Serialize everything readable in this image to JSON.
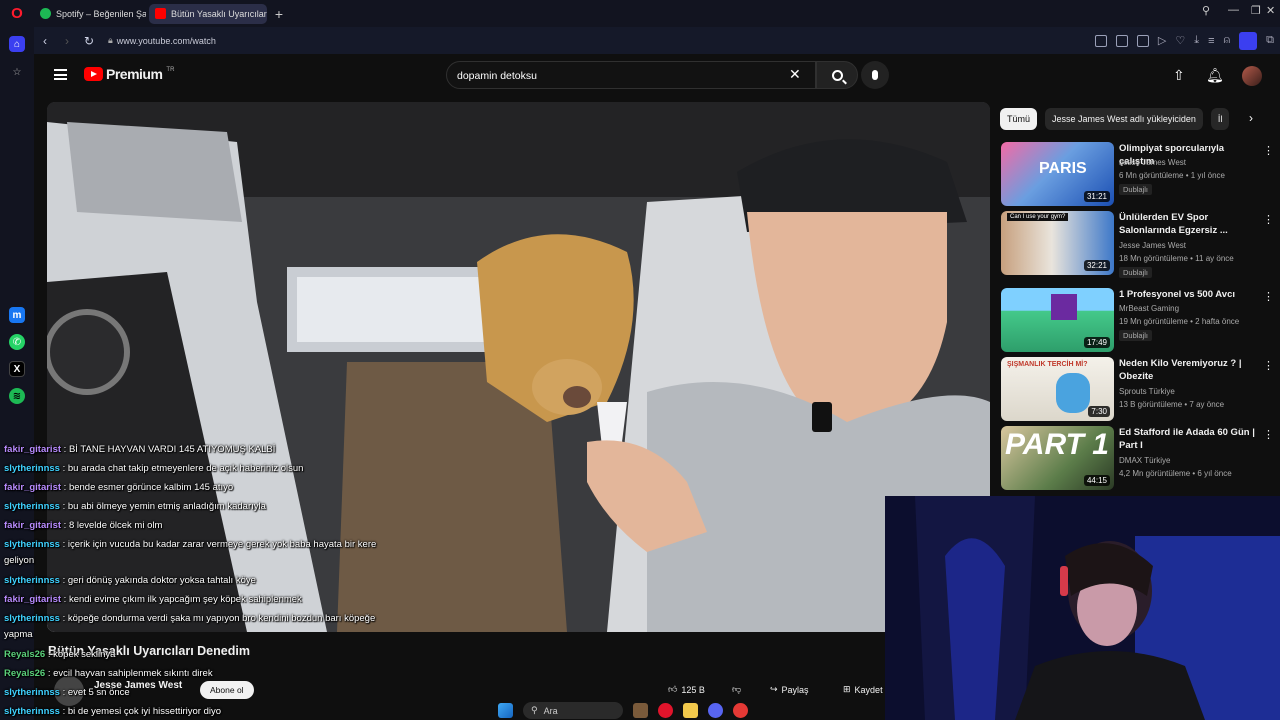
{
  "browser": {
    "tabs": [
      {
        "label": "Spotify – Beğenilen Şarkıla",
        "active": false,
        "favicon_color": "#1db954"
      },
      {
        "label": "Bütün Yasaklı Uyarıcılar",
        "active": true,
        "favicon_color": "#ff0000"
      }
    ],
    "url": "www.youtube.com/watch",
    "accent": "#ff1b2d"
  },
  "youtube": {
    "logo_text": "Premium",
    "logo_suffix": "TR",
    "search_query": "dopamin detoksu",
    "filter_chips": [
      "Tümü",
      "Jesse James West adlı yükleyiciden",
      "İl"
    ],
    "recommendations": [
      {
        "title": "Olimpiyat sporcularıyla çalıştım",
        "channel": "Jesse James West",
        "verified": true,
        "meta": "6 Mn görüntüleme • 1 yıl önce",
        "badge": "Dublajlı",
        "duration": "31:21"
      },
      {
        "title": "Ünlülerden EV Spor Salonlarında Egzersiz ...",
        "channel": "Jesse James West",
        "verified": true,
        "meta": "18 Mn görüntüleme • 11 ay önce",
        "badge": "Dublajlı",
        "duration": "32:21"
      },
      {
        "title": "1 Profesyonel vs 500 Avcı",
        "channel": "MrBeast Gaming",
        "verified": true,
        "meta": "19 Mn görüntüleme • 2 hafta önce",
        "badge": "Dublajlı",
        "duration": "17:49"
      },
      {
        "title": "Neden Kilo Veremiyoruz ? | Obezite",
        "channel": "Sprouts Türkiye",
        "verified": false,
        "meta": "13 B görüntüleme • 7 ay önce",
        "badge": "",
        "duration": "7:30"
      },
      {
        "title": "Ed Stafford ile Adada 60 Gün | Part I",
        "channel": "DMAX Türkiye",
        "verified": true,
        "meta": "4,2 Mn görüntüleme • 6 yıl önce",
        "badge": "",
        "duration": "44:15"
      }
    ],
    "video_title": "Bütün Yasaklı Uyarıcıları Denedim",
    "channel_name": "Jesse James West",
    "subscribe_label": "Abone ol",
    "likes": "125 B",
    "share_label": "Paylaş",
    "save_label": "Kaydet"
  },
  "chat": [
    {
      "user": "fakir_gitarist",
      "text": ": Bİ TANE HAYVAN VARDI 145 ATIYOMUŞ KALBİ",
      "color": "#b98cff"
    },
    {
      "user": "slytherinnss",
      "text": ": bu arada chat takip etmeyenlere de açık haberiniz olsun",
      "color": "#3fd1ff"
    },
    {
      "user": "fakir_gitarist",
      "text": ": bende esmer görünce kalbim 145 atıyo",
      "color": "#b98cff"
    },
    {
      "user": "slytherinnss",
      "text": ": bu abi ölmeye yemin etmiş anladığım kadarıyla",
      "color": "#3fd1ff"
    },
    {
      "user": "fakir_gitarist",
      "text": ": 8 levelde ölcek mi olm",
      "color": "#b98cff"
    },
    {
      "user": "slytherinnss",
      "text": ": içerik için vucuda bu kadar zarar vermeye gerek yok baba hayata bir kere geliyon",
      "color": "#3fd1ff"
    },
    {
      "user": "slytherinnss",
      "text": ": geri dönüş yakında doktor yoksa tahtalı köye",
      "color": "#3fd1ff"
    },
    {
      "user": "fakir_gitarist",
      "text": ": kendi evime çıkım ilk yapcağım şey köpek sahiplenmek",
      "color": "#b98cff"
    },
    {
      "user": "slytherinnss",
      "text": ": köpeğe dondurma verdi şaka mı yapıyon bro kendini bozdun barı köpeğe yapma",
      "color": "#3fd1ff"
    },
    {
      "user": "Reyals26",
      "text": ": köpek seklinya",
      "color": "#5ad07a"
    },
    {
      "user": "Reyals26",
      "text": ": evcil hayvan sahiplenmek sıkıntı direk",
      "color": "#5ad07a"
    },
    {
      "user": "slytherinnss",
      "text": ": evet 5 sn önce",
      "color": "#3fd1ff"
    },
    {
      "user": "slytherinnss",
      "text": ": bi de yemesi çok iyi hissettiriyor diyo",
      "color": "#3fd1ff"
    }
  ],
  "taskbar": {
    "search_placeholder": "Ara"
  }
}
